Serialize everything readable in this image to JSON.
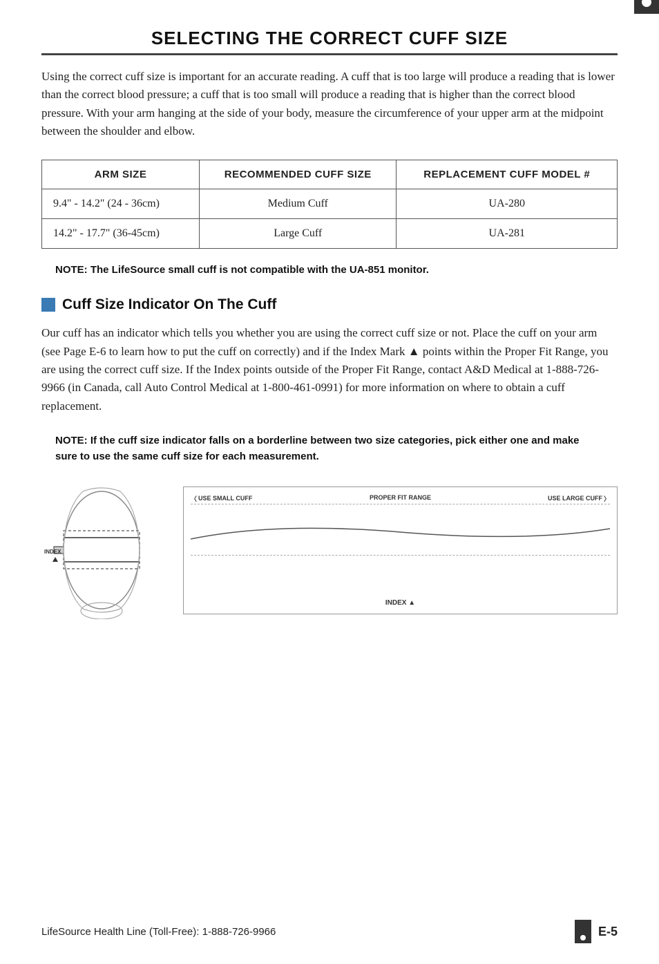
{
  "header": {
    "title": "SELECTING THE CORRECT CUFF SIZE"
  },
  "intro": {
    "text": "Using the correct cuff size is important for an accurate reading.  A cuff that is too large will produce a reading that is lower than the correct blood pressure; a cuff that is too small will produce a reading that is higher than the correct blood pressure.  With your arm hanging at the side of your body, measure the circumference of your upper arm at the midpoint between the shoulder and elbow."
  },
  "table": {
    "headers": [
      "ARM SIZE",
      "RECOMMENDED CUFF SIZE",
      "REPLACEMENT CUFF MODEL #"
    ],
    "rows": [
      [
        "9.4\" - 14.2\" (24 - 36cm)",
        "Medium Cuff",
        "UA-280"
      ],
      [
        "14.2\" - 17.7\" (36-45cm)",
        "Large Cuff",
        "UA-281"
      ]
    ]
  },
  "note1": {
    "text": "NOTE: The LifeSource small cuff is not compatible with the UA-851 monitor."
  },
  "section": {
    "icon_color": "#3a7ab5",
    "title": "Cuff Size Indicator On The Cuff"
  },
  "body_text": {
    "text": "Our cuff has an indicator which tells you whether you are using the correct cuff size or not. Place the cuff on your arm (see Page E-6 to learn how to put the cuff on correctly) and if the Index Mark ▲ points within the Proper Fit Range, you are using the correct cuff size. If the Index points outside of the Proper Fit Range, contact A&D Medical at 1-888-726-9966 (in Canada, call Auto Control Medical at 1-800-461-0991) for more information on where to obtain a cuff replacement."
  },
  "note2": {
    "text": "NOTE: If the cuff size indicator falls on a borderline between two size categories, pick either one and make sure to use the same cuff size for each measurement."
  },
  "diagram": {
    "use_small_cuff": "USE SMALL CUFF",
    "proper_fit_range": "PROPER FIT RANGE",
    "use_large_cuff": "USE LARGE CUFF",
    "index_label": "INDEX ▲"
  },
  "footer": {
    "left": "LifeSource Health Line (Toll-Free):  1-888-726-9966",
    "page": "E-5"
  }
}
